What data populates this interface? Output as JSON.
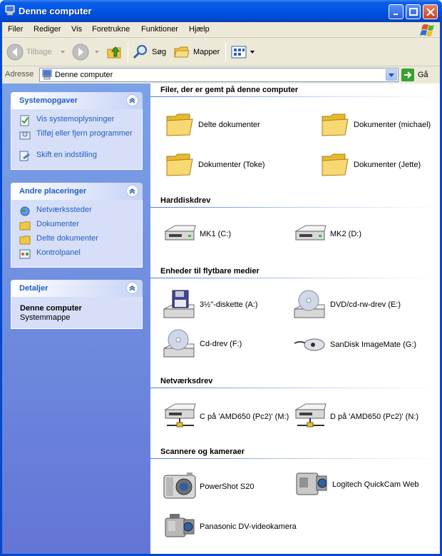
{
  "window": {
    "title": "Denne computer"
  },
  "menu": [
    "Filer",
    "Rediger",
    "Vis",
    "Foretrukne",
    "Funktioner",
    "Hjælp"
  ],
  "toolbar": {
    "back": "Tilbage",
    "search": "Søg",
    "folders": "Mapper"
  },
  "address": {
    "label": "Adresse",
    "value": "Denne computer",
    "go": "Gå"
  },
  "sidebar": {
    "system": {
      "title": "Systemopgaver",
      "items": [
        "Vis systemoplysninger",
        "Tilføj eller fjern programmer",
        "Skift en indstilling"
      ]
    },
    "places": {
      "title": "Andre placeringer",
      "items": [
        "Netværkssteder",
        "Dokumenter",
        "Delte dokumenter",
        "Kontrolpanel"
      ]
    },
    "details": {
      "title": "Detaljer",
      "name": "Denne computer",
      "type": "Systemmappe"
    }
  },
  "groups": {
    "files": {
      "title": "Filer, der er gemt på denne computer",
      "items": [
        "Delte dokumenter",
        "Dokumenter (michael)",
        "Dokumenter (Toke)",
        "Dokumenter (Jette)"
      ]
    },
    "hdd": {
      "title": "Harddiskdrev",
      "items": [
        "MK1 (C:)",
        "MK2 (D:)"
      ]
    },
    "removable": {
      "title": "Enheder til flytbare medier",
      "items": [
        "3½\"-diskette (A:)",
        "DVD/cd-rw-drev (E:)",
        "Cd-drev (F:)",
        "SanDisk ImageMate (G:)"
      ]
    },
    "network": {
      "title": "Netværksdrev",
      "items": [
        "C på 'AMD650 (Pc2)' (M:)",
        "D på 'AMD650 (Pc2)' (N:)"
      ]
    },
    "scanners": {
      "title": "Scannere og kameraer",
      "items": [
        "PowerShot S20",
        "Logitech QuickCam Web",
        "Panasonic DV-videokamera"
      ]
    }
  },
  "colors": {
    "titlebar": "#0055e5",
    "sidebar": "#6f8fe0",
    "link": "#215dc6"
  }
}
